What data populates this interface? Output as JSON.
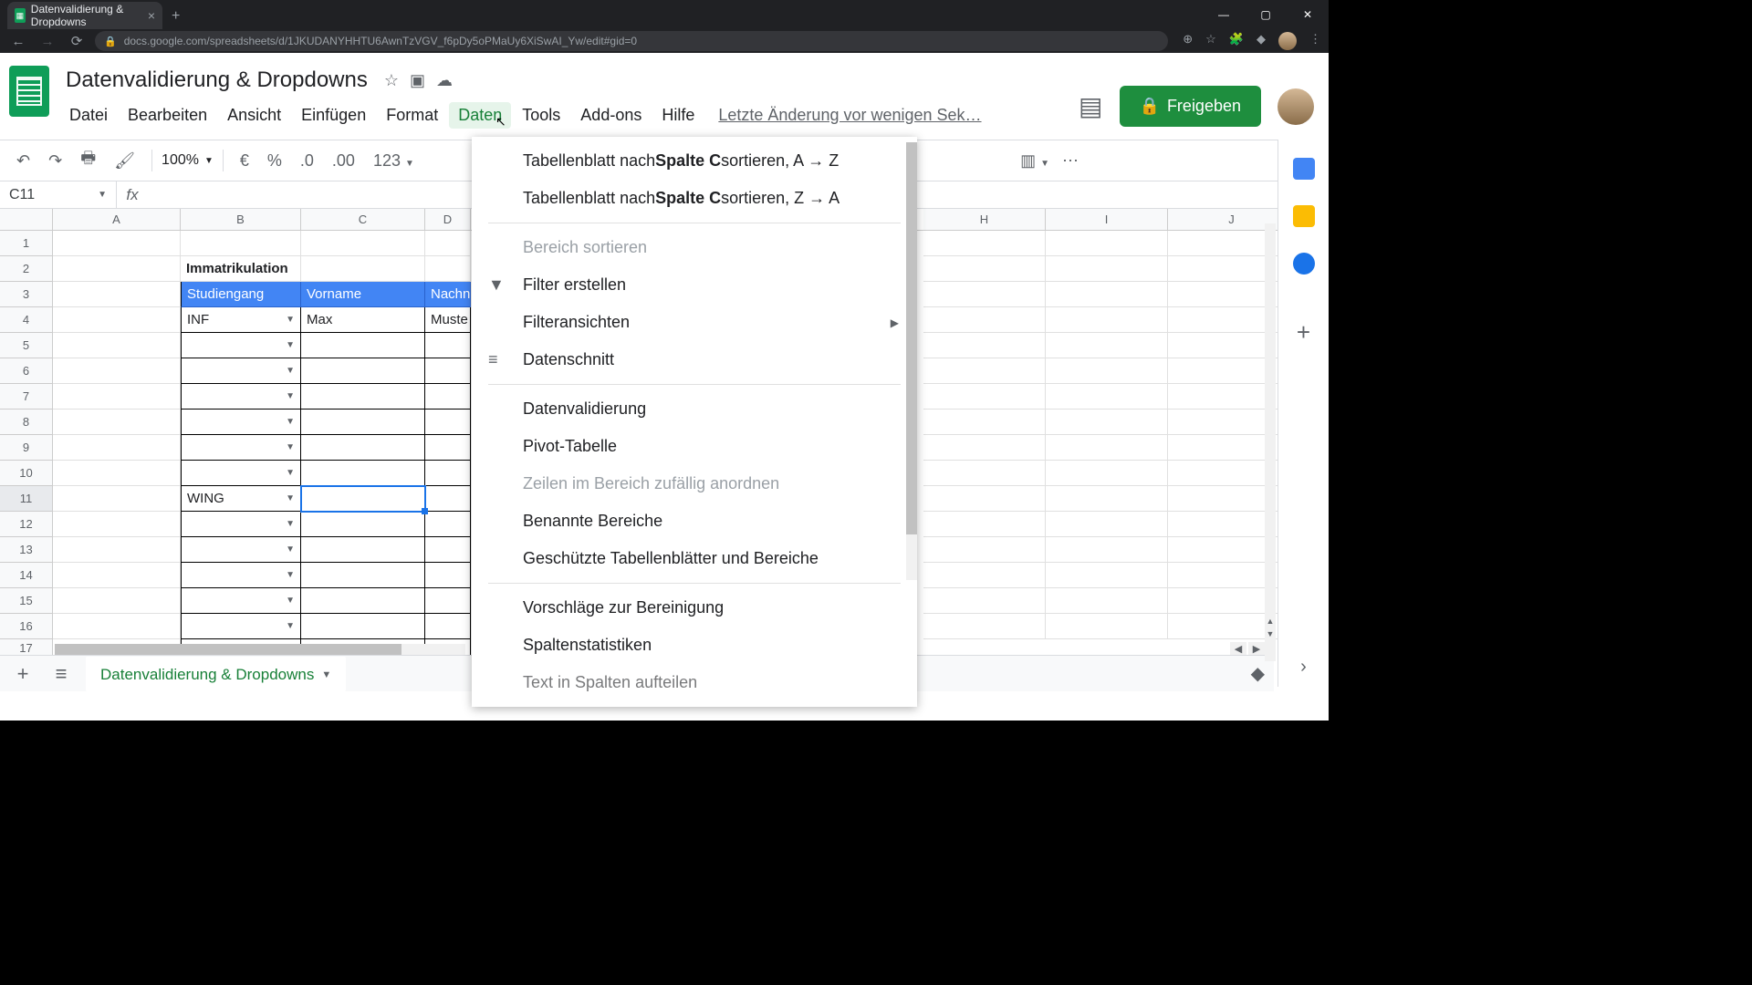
{
  "browser": {
    "tab_title": "Datenvalidierung & Dropdowns",
    "url": "docs.google.com/spreadsheets/d/1JKUDANYHHTU6AwnTzVGV_f6pDy5oPMaUy6XiSwAI_Yw/edit#gid=0"
  },
  "doc": {
    "title": "Datenvalidierung & Dropdowns",
    "last_edit": "Letzte Änderung vor wenigen Sek…"
  },
  "menubar": [
    "Datei",
    "Bearbeiten",
    "Ansicht",
    "Einfügen",
    "Format",
    "Daten",
    "Tools",
    "Add-ons",
    "Hilfe"
  ],
  "menubar_active_index": 5,
  "share_label": "Freigeben",
  "toolbar": {
    "zoom": "100%",
    "currency": "€",
    "percent": "%",
    "dec_less": ".0",
    "dec_more": ".00",
    "format_num": "123"
  },
  "namebox": "C11",
  "columns": [
    "A",
    "B",
    "C",
    "D",
    "H",
    "I",
    "J"
  ],
  "rows": [
    "1",
    "2",
    "3",
    "4",
    "5",
    "6",
    "7",
    "8",
    "9",
    "10",
    "11",
    "12",
    "13",
    "14",
    "15",
    "16",
    "17"
  ],
  "table": {
    "title": "Immatrikulation",
    "headers": [
      "Studiengang",
      "Vorname",
      "Nachn"
    ],
    "r4": {
      "b": "INF",
      "c": "Max",
      "d": "Muste"
    },
    "r11_b": "WING"
  },
  "data_menu": {
    "sort_asc_pre": "Tabellenblatt nach ",
    "sort_asc_col": "Spalte C",
    "sort_asc_post": " sortieren, A → Z",
    "sort_desc_pre": "Tabellenblatt nach ",
    "sort_desc_col": "Spalte C",
    "sort_desc_post": " sortieren, Z → A",
    "sort_range": "Bereich sortieren",
    "create_filter": "Filter erstellen",
    "filter_views": "Filteransichten",
    "slicer": "Datenschnitt",
    "validation": "Datenvalidierung",
    "pivot": "Pivot-Tabelle",
    "randomize": "Zeilen im Bereich zufällig anordnen",
    "named_ranges": "Benannte Bereiche",
    "protected": "Geschützte Tabellenblätter und Bereiche",
    "cleanup": "Vorschläge zur Bereinigung",
    "col_stats": "Spaltenstatistiken",
    "split_text": "Text in Spalten aufteilen"
  },
  "sheet_tab": "Datenvalidierung & Dropdowns"
}
